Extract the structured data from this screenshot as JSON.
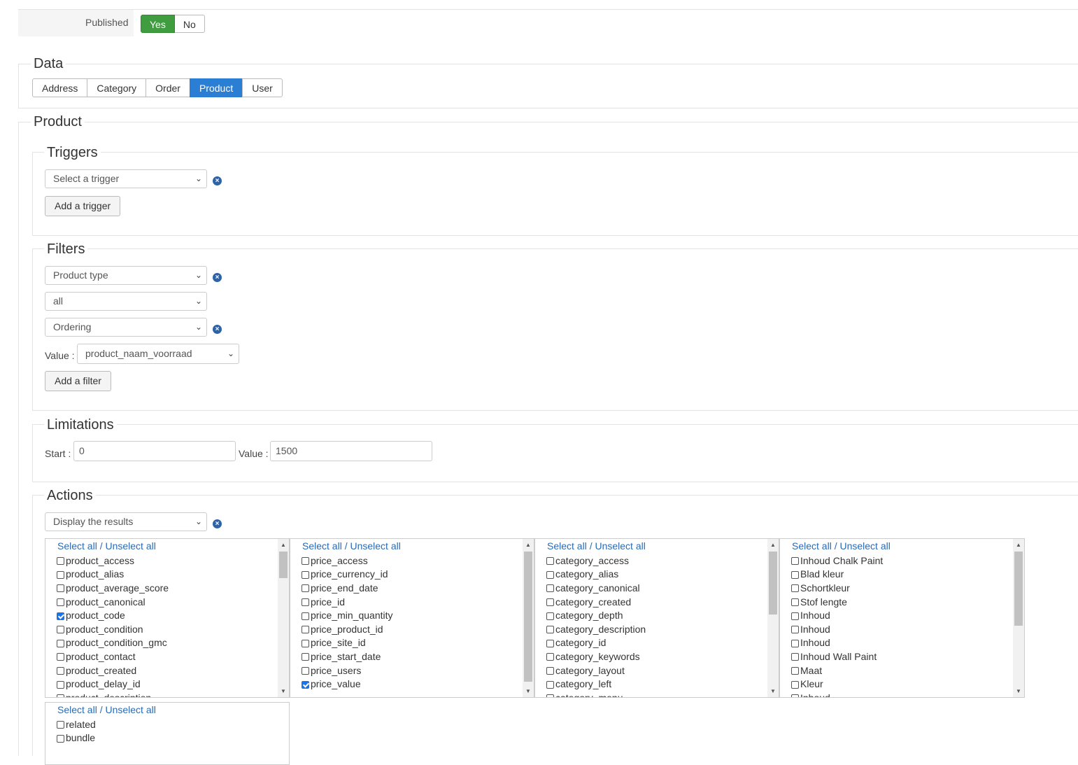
{
  "published": {
    "label": "Published",
    "yes": "Yes",
    "no": "No"
  },
  "data_section": {
    "title": "Data",
    "tabs": [
      "Address",
      "Category",
      "Order",
      "Product",
      "User"
    ],
    "active_tab": "Product"
  },
  "product_section": {
    "title": "Product"
  },
  "triggers": {
    "title": "Triggers",
    "select": "Select a trigger",
    "add_button": "Add a trigger"
  },
  "filters": {
    "title": "Filters",
    "product_type": "Product type",
    "all": "all",
    "ordering": "Ordering",
    "value_label": "Value :",
    "value": "product_naam_voorraad",
    "add_button": "Add a filter"
  },
  "limitations": {
    "title": "Limitations",
    "start_label": "Start :",
    "start": "0",
    "value_label": "Value :",
    "value": "1500"
  },
  "actions": {
    "title": "Actions",
    "select": "Display the results",
    "select_all": "Select all / Unselect all",
    "lists": [
      {
        "items": [
          {
            "label": "product_access",
            "checked": false
          },
          {
            "label": "product_alias",
            "checked": false
          },
          {
            "label": "product_average_score",
            "checked": false
          },
          {
            "label": "product_canonical",
            "checked": false
          },
          {
            "label": "product_code",
            "checked": true
          },
          {
            "label": "product_condition",
            "checked": false
          },
          {
            "label": "product_condition_gmc",
            "checked": false
          },
          {
            "label": "product_contact",
            "checked": false
          },
          {
            "label": "product_created",
            "checked": false
          },
          {
            "label": "product_delay_id",
            "checked": false
          },
          {
            "label": "product_description",
            "checked": false
          }
        ],
        "scroll": 0.0
      },
      {
        "items": [
          {
            "label": "price_access",
            "checked": false
          },
          {
            "label": "price_currency_id",
            "checked": false
          },
          {
            "label": "price_end_date",
            "checked": false
          },
          {
            "label": "price_id",
            "checked": false
          },
          {
            "label": "price_min_quantity",
            "checked": false
          },
          {
            "label": "price_product_id",
            "checked": false
          },
          {
            "label": "price_site_id",
            "checked": false
          },
          {
            "label": "price_start_date",
            "checked": false
          },
          {
            "label": "price_users",
            "checked": false
          },
          {
            "label": "price_value",
            "checked": true
          }
        ],
        "scroll": 0.0
      },
      {
        "items": [
          {
            "label": "category_access",
            "checked": false
          },
          {
            "label": "category_alias",
            "checked": false
          },
          {
            "label": "category_canonical",
            "checked": false
          },
          {
            "label": "category_created",
            "checked": false
          },
          {
            "label": "category_depth",
            "checked": false
          },
          {
            "label": "category_description",
            "checked": false
          },
          {
            "label": "category_id",
            "checked": false
          },
          {
            "label": "category_keywords",
            "checked": false
          },
          {
            "label": "category_layout",
            "checked": false
          },
          {
            "label": "category_left",
            "checked": false
          },
          {
            "label": "category_menu",
            "checked": false
          }
        ],
        "scroll": 0.0
      },
      {
        "items": [
          {
            "label": "Inhoud Chalk Paint",
            "checked": false
          },
          {
            "label": "Blad kleur",
            "checked": false
          },
          {
            "label": "Schortkleur",
            "checked": false
          },
          {
            "label": "Stof lengte",
            "checked": false
          },
          {
            "label": "Inhoud",
            "checked": false
          },
          {
            "label": "Inhoud",
            "checked": false
          },
          {
            "label": "Inhoud",
            "checked": false
          },
          {
            "label": "Inhoud Wall Paint",
            "checked": false
          },
          {
            "label": "Maat",
            "checked": false
          },
          {
            "label": "Kleur",
            "checked": false
          },
          {
            "label": "Inhoud",
            "checked": false
          }
        ],
        "scroll": 0.0
      },
      {
        "items": [
          {
            "label": "related",
            "checked": false
          },
          {
            "label": "bundle",
            "checked": false
          }
        ]
      }
    ]
  }
}
